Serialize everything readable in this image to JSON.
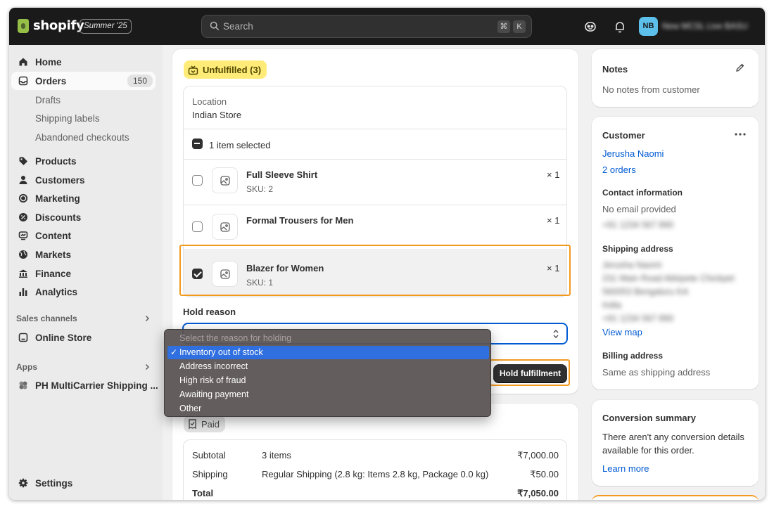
{
  "topbar": {
    "brand": "shopify",
    "edition": "Summer '25",
    "search_placeholder": "Search",
    "kbd_cmd": "⌘",
    "kbd_k": "K",
    "avatar_initials": "NB",
    "store_name": "New MCSL Live BASU"
  },
  "sidebar": {
    "home": "Home",
    "orders": "Orders",
    "orders_count": "150",
    "drafts": "Drafts",
    "shipping_labels": "Shipping labels",
    "abandoned_checkouts": "Abandoned checkouts",
    "products": "Products",
    "customers": "Customers",
    "marketing": "Marketing",
    "discounts": "Discounts",
    "content": "Content",
    "markets": "Markets",
    "finance": "Finance",
    "analytics": "Analytics",
    "sales_channels": "Sales channels",
    "online_store": "Online Store",
    "apps": "Apps",
    "ph_app": "PH MultiCarrier Shipping ...",
    "settings": "Settings"
  },
  "fulfillment": {
    "badge": "Unfulfilled (3)",
    "location_label": "Location",
    "location_value": "Indian Store",
    "selected_text": "1 item selected",
    "items": [
      {
        "name": "Full Sleeve Shirt",
        "sku": "SKU: 2",
        "qty": "× 1",
        "checked": false
      },
      {
        "name": "Formal Trousers for Men",
        "sku": "",
        "qty": "× 1",
        "checked": false
      },
      {
        "name": "Blazer for Women",
        "sku": "SKU: 1",
        "qty": "× 1",
        "checked": true
      }
    ],
    "hold_reason_label": "Hold reason",
    "hold_button": "Hold fulfillment"
  },
  "dropdown": {
    "options": [
      {
        "label": "Select the reason for holding",
        "disabled": true
      },
      {
        "label": "Inventory out of stock",
        "selected": true
      },
      {
        "label": "Address incorrect"
      },
      {
        "label": "High risk of fraud"
      },
      {
        "label": "Awaiting payment"
      },
      {
        "label": "Other"
      }
    ],
    "check": "✓"
  },
  "payment": {
    "badge": "Paid",
    "rows": [
      {
        "label": "Subtotal",
        "desc": "3 items",
        "amount": "₹7,000.00"
      },
      {
        "label": "Shipping",
        "desc": "Regular Shipping (2.8 kg: Items 2.8 kg, Package 0.0 kg)",
        "amount": "₹50.00"
      },
      {
        "label": "Total",
        "desc": "",
        "amount": "₹7,050.00"
      }
    ]
  },
  "notes": {
    "title": "Notes",
    "text": "No notes from customer"
  },
  "customer": {
    "title": "Customer",
    "name": "Jerusha Naomi",
    "orders": "2 orders",
    "contact_title": "Contact information",
    "email": "No email provided",
    "phone": "+91 1234 567 890",
    "shipping_title": "Shipping address",
    "address_lines": [
      "Jerusha Naomi",
      "231 Main Road Akkipete Chickpet",
      "560053 Bengaluru KA",
      "India",
      "+91 1234 567 890"
    ],
    "view_map": "View map",
    "billing_title": "Billing address",
    "billing_text": "Same as shipping address"
  },
  "conversion": {
    "title": "Conversion summary",
    "text_line1": "There aren't any conversion details",
    "text_line2": "available for this order.",
    "link": "Learn more"
  },
  "colors": {
    "accent": "#005bd3",
    "highlight": "#f29a1f",
    "unfulfilled_bg": "#ffeb78"
  }
}
